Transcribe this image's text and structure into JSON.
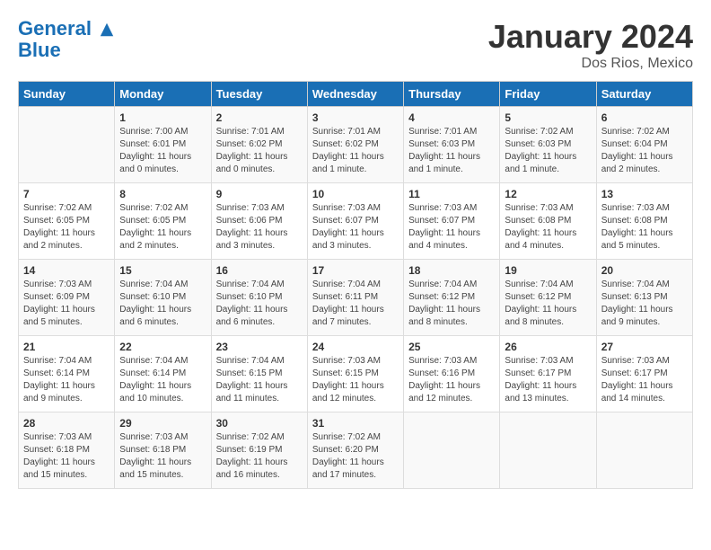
{
  "logo": {
    "line1": "General",
    "line2": "Blue"
  },
  "title": "January 2024",
  "location": "Dos Rios, Mexico",
  "days_header": [
    "Sunday",
    "Monday",
    "Tuesday",
    "Wednesday",
    "Thursday",
    "Friday",
    "Saturday"
  ],
  "weeks": [
    [
      {
        "day": "",
        "content": ""
      },
      {
        "day": "1",
        "content": "Sunrise: 7:00 AM\nSunset: 6:01 PM\nDaylight: 11 hours\nand 0 minutes."
      },
      {
        "day": "2",
        "content": "Sunrise: 7:01 AM\nSunset: 6:02 PM\nDaylight: 11 hours\nand 0 minutes."
      },
      {
        "day": "3",
        "content": "Sunrise: 7:01 AM\nSunset: 6:02 PM\nDaylight: 11 hours\nand 1 minute."
      },
      {
        "day": "4",
        "content": "Sunrise: 7:01 AM\nSunset: 6:03 PM\nDaylight: 11 hours\nand 1 minute."
      },
      {
        "day": "5",
        "content": "Sunrise: 7:02 AM\nSunset: 6:03 PM\nDaylight: 11 hours\nand 1 minute."
      },
      {
        "day": "6",
        "content": "Sunrise: 7:02 AM\nSunset: 6:04 PM\nDaylight: 11 hours\nand 2 minutes."
      }
    ],
    [
      {
        "day": "7",
        "content": "Sunrise: 7:02 AM\nSunset: 6:05 PM\nDaylight: 11 hours\nand 2 minutes."
      },
      {
        "day": "8",
        "content": "Sunrise: 7:02 AM\nSunset: 6:05 PM\nDaylight: 11 hours\nand 2 minutes."
      },
      {
        "day": "9",
        "content": "Sunrise: 7:03 AM\nSunset: 6:06 PM\nDaylight: 11 hours\nand 3 minutes."
      },
      {
        "day": "10",
        "content": "Sunrise: 7:03 AM\nSunset: 6:07 PM\nDaylight: 11 hours\nand 3 minutes."
      },
      {
        "day": "11",
        "content": "Sunrise: 7:03 AM\nSunset: 6:07 PM\nDaylight: 11 hours\nand 4 minutes."
      },
      {
        "day": "12",
        "content": "Sunrise: 7:03 AM\nSunset: 6:08 PM\nDaylight: 11 hours\nand 4 minutes."
      },
      {
        "day": "13",
        "content": "Sunrise: 7:03 AM\nSunset: 6:08 PM\nDaylight: 11 hours\nand 5 minutes."
      }
    ],
    [
      {
        "day": "14",
        "content": "Sunrise: 7:03 AM\nSunset: 6:09 PM\nDaylight: 11 hours\nand 5 minutes."
      },
      {
        "day": "15",
        "content": "Sunrise: 7:04 AM\nSunset: 6:10 PM\nDaylight: 11 hours\nand 6 minutes."
      },
      {
        "day": "16",
        "content": "Sunrise: 7:04 AM\nSunset: 6:10 PM\nDaylight: 11 hours\nand 6 minutes."
      },
      {
        "day": "17",
        "content": "Sunrise: 7:04 AM\nSunset: 6:11 PM\nDaylight: 11 hours\nand 7 minutes."
      },
      {
        "day": "18",
        "content": "Sunrise: 7:04 AM\nSunset: 6:12 PM\nDaylight: 11 hours\nand 8 minutes."
      },
      {
        "day": "19",
        "content": "Sunrise: 7:04 AM\nSunset: 6:12 PM\nDaylight: 11 hours\nand 8 minutes."
      },
      {
        "day": "20",
        "content": "Sunrise: 7:04 AM\nSunset: 6:13 PM\nDaylight: 11 hours\nand 9 minutes."
      }
    ],
    [
      {
        "day": "21",
        "content": "Sunrise: 7:04 AM\nSunset: 6:14 PM\nDaylight: 11 hours\nand 9 minutes."
      },
      {
        "day": "22",
        "content": "Sunrise: 7:04 AM\nSunset: 6:14 PM\nDaylight: 11 hours\nand 10 minutes."
      },
      {
        "day": "23",
        "content": "Sunrise: 7:04 AM\nSunset: 6:15 PM\nDaylight: 11 hours\nand 11 minutes."
      },
      {
        "day": "24",
        "content": "Sunrise: 7:03 AM\nSunset: 6:15 PM\nDaylight: 11 hours\nand 12 minutes."
      },
      {
        "day": "25",
        "content": "Sunrise: 7:03 AM\nSunset: 6:16 PM\nDaylight: 11 hours\nand 12 minutes."
      },
      {
        "day": "26",
        "content": "Sunrise: 7:03 AM\nSunset: 6:17 PM\nDaylight: 11 hours\nand 13 minutes."
      },
      {
        "day": "27",
        "content": "Sunrise: 7:03 AM\nSunset: 6:17 PM\nDaylight: 11 hours\nand 14 minutes."
      }
    ],
    [
      {
        "day": "28",
        "content": "Sunrise: 7:03 AM\nSunset: 6:18 PM\nDaylight: 11 hours\nand 15 minutes."
      },
      {
        "day": "29",
        "content": "Sunrise: 7:03 AM\nSunset: 6:18 PM\nDaylight: 11 hours\nand 15 minutes."
      },
      {
        "day": "30",
        "content": "Sunrise: 7:02 AM\nSunset: 6:19 PM\nDaylight: 11 hours\nand 16 minutes."
      },
      {
        "day": "31",
        "content": "Sunrise: 7:02 AM\nSunset: 6:20 PM\nDaylight: 11 hours\nand 17 minutes."
      },
      {
        "day": "",
        "content": ""
      },
      {
        "day": "",
        "content": ""
      },
      {
        "day": "",
        "content": ""
      }
    ]
  ]
}
